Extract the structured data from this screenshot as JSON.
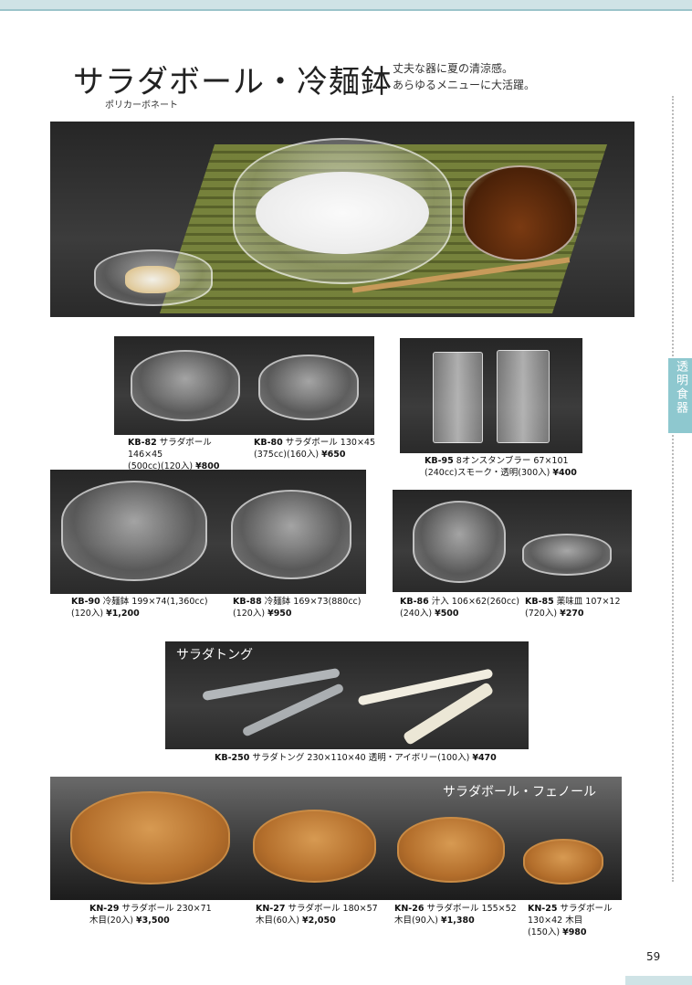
{
  "header": {
    "title": "サラダボール・冷麺鉢",
    "subtitle": "ポリカーボネート",
    "tagline_1": "丈夫な器に夏の清涼感。",
    "tagline_2": "あらゆるメニューに大活躍。"
  },
  "side_tab": {
    "label": "透明食器"
  },
  "products": {
    "kb82": {
      "code": "KB-82",
      "line1": " サラダボール 146×45",
      "line2": "(500cc)(120入) ",
      "price": "¥800"
    },
    "kb80": {
      "code": "KB-80",
      "line1": " サラダボール 130×45",
      "line2": "(375cc)(160入) ",
      "price": "¥650"
    },
    "kb95": {
      "code": "KB-95",
      "line1": " 8オンスタンブラー 67×101",
      "line2": "(240cc)スモーク・透明(300入) ",
      "price": "¥400"
    },
    "kb90": {
      "code": "KB-90",
      "line1": " 冷麺鉢 199×74(1,360cc)",
      "line2": "(120入) ",
      "price": "¥1,200"
    },
    "kb88": {
      "code": "KB-88",
      "line1": " 冷麺鉢 169×73(880cc)",
      "line2": "(120入) ",
      "price": "¥950"
    },
    "kb86": {
      "code": "KB-86",
      "line1": " 汁入 106×62(260cc)",
      "line2": "(240入) ",
      "price": "¥500"
    },
    "kb85": {
      "code": "KB-85",
      "line1": " 薬味皿 107×12",
      "line2": "(720入) ",
      "price": "¥270"
    },
    "kb250": {
      "code": "KB-250",
      "line1": " サラダトング 230×110×40 透明・アイボリー(100入) ",
      "price": "¥470"
    },
    "kn29": {
      "code": "KN-29",
      "line1": " サラダボール 230×71",
      "line2": "木目(20入) ",
      "price": "¥3,500"
    },
    "kn27": {
      "code": "KN-27",
      "line1": " サラダボール 180×57",
      "line2": "木目(60入) ",
      "price": "¥2,050"
    },
    "kn26": {
      "code": "KN-26",
      "line1": " サラダボール 155×52",
      "line2": "木目(90入) ",
      "price": "¥1,380"
    },
    "kn25": {
      "code": "KN-25",
      "line1": " サラダボール",
      "line2": "130×42 木目",
      "line3": "(150入) ",
      "price": "¥980"
    }
  },
  "banners": {
    "tongs": "サラダトング",
    "phenol": "サラダボール・フェノール"
  },
  "page_number": "59"
}
